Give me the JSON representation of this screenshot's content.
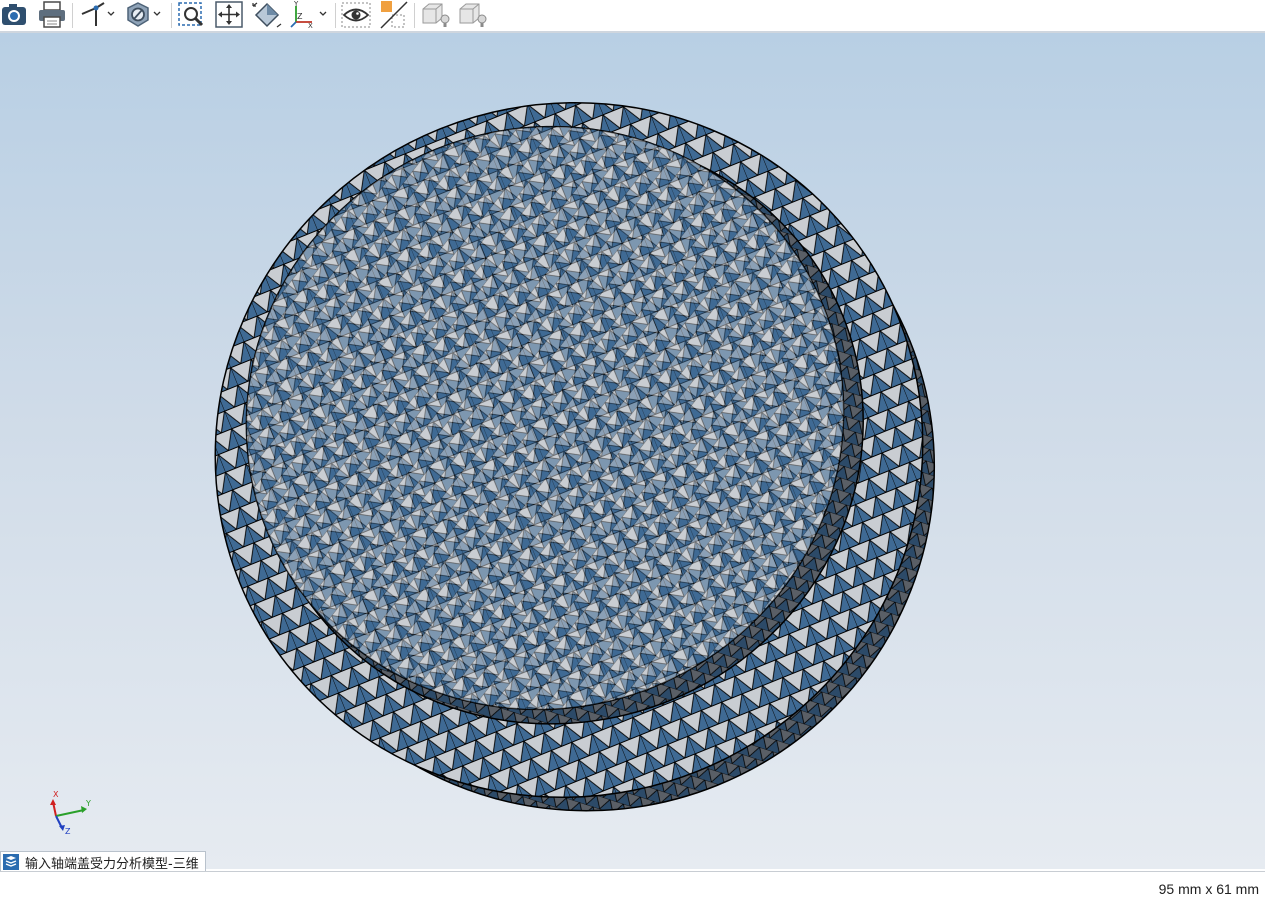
{
  "toolbar": {
    "items": [
      {
        "name": "camera-icon",
        "has_dropdown": false
      },
      {
        "name": "printer-icon",
        "has_dropdown": false
      },
      {
        "name": "axis-triad-icon",
        "has_dropdown": true
      },
      {
        "name": "hide-hexagon-icon",
        "has_dropdown": true
      },
      {
        "name": "zoom-window-icon",
        "has_dropdown": false
      },
      {
        "name": "pan-icon",
        "has_dropdown": false
      },
      {
        "name": "zoom-fit-icon",
        "has_dropdown": false
      },
      {
        "name": "coordinate-axes-icon",
        "has_dropdown": true
      },
      {
        "name": "view-eye-icon",
        "has_dropdown": false
      },
      {
        "name": "section-plane-icon",
        "has_dropdown": false
      },
      {
        "name": "light-box-icon",
        "has_dropdown": false
      },
      {
        "name": "light-box-icon-2",
        "has_dropdown": false
      }
    ],
    "axis_labels": {
      "x": "X",
      "y": "Y",
      "z": "Z"
    }
  },
  "viewport": {
    "triad_labels": {
      "x": "X",
      "y": "Y",
      "z": "Z"
    },
    "colors": {
      "mesh_fill": "#3f6a94",
      "mesh_light": "#c9cdd2",
      "edges": "#000000"
    }
  },
  "document_tab": {
    "label": "输入轴端盖受力分析模型-三维"
  },
  "status": {
    "dimensions": "95 mm x 61 mm"
  }
}
